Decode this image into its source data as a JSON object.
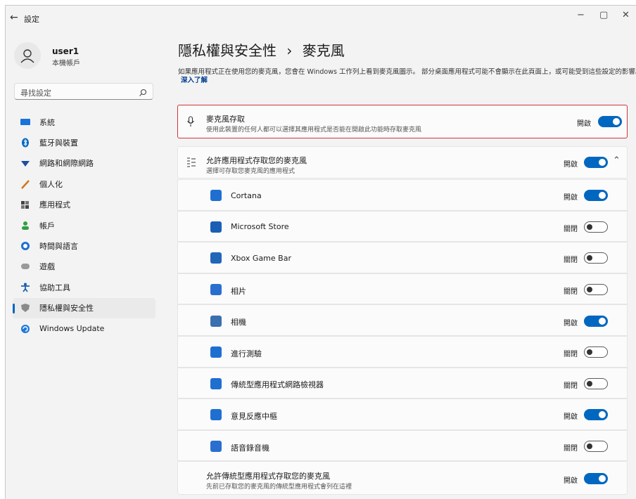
{
  "window": {
    "title": "設定",
    "minimize": "−",
    "maximize": "▢",
    "close": "✕",
    "back": "←"
  },
  "user": {
    "name": "user1",
    "type": "本機帳戶"
  },
  "search": {
    "placeholder": "尋找設定"
  },
  "sidebar": {
    "items": [
      {
        "label": "系統",
        "icon": "monitor-icon",
        "color": "#1a73d9"
      },
      {
        "label": "藍牙與裝置",
        "icon": "bluetooth-icon",
        "color": "#0067c0"
      },
      {
        "label": "網路和網際網路",
        "icon": "wifi-icon",
        "color": "#1a4fa0"
      },
      {
        "label": "個人化",
        "icon": "brush-icon",
        "color": "#c87a1f"
      },
      {
        "label": "應用程式",
        "icon": "apps-icon",
        "color": "#555555"
      },
      {
        "label": "帳戶",
        "icon": "person-icon",
        "color": "#2ea043"
      },
      {
        "label": "時間與語言",
        "icon": "globe-clock-icon",
        "color": "#1f6fd1"
      },
      {
        "label": "遊戲",
        "icon": "gamepad-icon",
        "color": "#8a8a8a"
      },
      {
        "label": "協助工具",
        "icon": "accessibility-icon",
        "color": "#1a5fb4"
      },
      {
        "label": "隱私權與安全性",
        "icon": "shield-icon",
        "color": "#777777",
        "active": true
      },
      {
        "label": "Windows Update",
        "icon": "update-icon",
        "color": "#1f7ad8"
      }
    ]
  },
  "main": {
    "breadcrumb_parent": "隱私權與安全性",
    "breadcrumb_sep": "›",
    "breadcrumb_current": "麥克風",
    "description": "如果應用程式正在使用您的麥克風，您會在 Windows 工作列上看到麥克風圖示。 部分桌面應用程式可能不會顯示在此頁面上，或可能受到這些設定的影響。",
    "learn_more": "深入了解",
    "mic_access": {
      "title": "麥克風存取",
      "subtitle": "使用此裝置的任何人都可以選擇其應用程式是否能在開啟此功能時存取麥克風",
      "state": "開啟"
    },
    "app_access": {
      "title": "允許應用程式存取您的麥克風",
      "subtitle": "選擇可存取您麥克風的應用程式",
      "state": "開啟"
    },
    "apps": [
      {
        "name": "Cortana",
        "state": "開啟",
        "on": true,
        "color": "#1f6fd1"
      },
      {
        "name": "Microsoft Store",
        "state": "關閉",
        "on": false,
        "color": "#1a5fb4"
      },
      {
        "name": "Xbox Game Bar",
        "state": "關閉",
        "on": false,
        "color": "#2266b8"
      },
      {
        "name": "相片",
        "state": "關閉",
        "on": false,
        "color": "#2a6fcf"
      },
      {
        "name": "相機",
        "state": "開啟",
        "on": true,
        "color": "#3a6fb0"
      },
      {
        "name": "進行測驗",
        "state": "關閉",
        "on": false,
        "color": "#1f6fd1"
      },
      {
        "name": "傳統型應用程式網路檢視器",
        "state": "關閉",
        "on": false,
        "color": "#1f6fd1"
      },
      {
        "name": "意見反應中樞",
        "state": "開啟",
        "on": true,
        "color": "#1f6fd1"
      },
      {
        "name": "語音錄音機",
        "state": "關閉",
        "on": false,
        "color": "#2a6fcf"
      }
    ],
    "desktop_apps": {
      "title": "允許傳統型應用程式存取您的麥克風",
      "subtitle": "先前已存取您的麥克風的傳統型應用程式會列在這裡",
      "state": "開啟"
    }
  },
  "colors": {
    "accent": "#0067c0",
    "highlight": "#d13438"
  }
}
